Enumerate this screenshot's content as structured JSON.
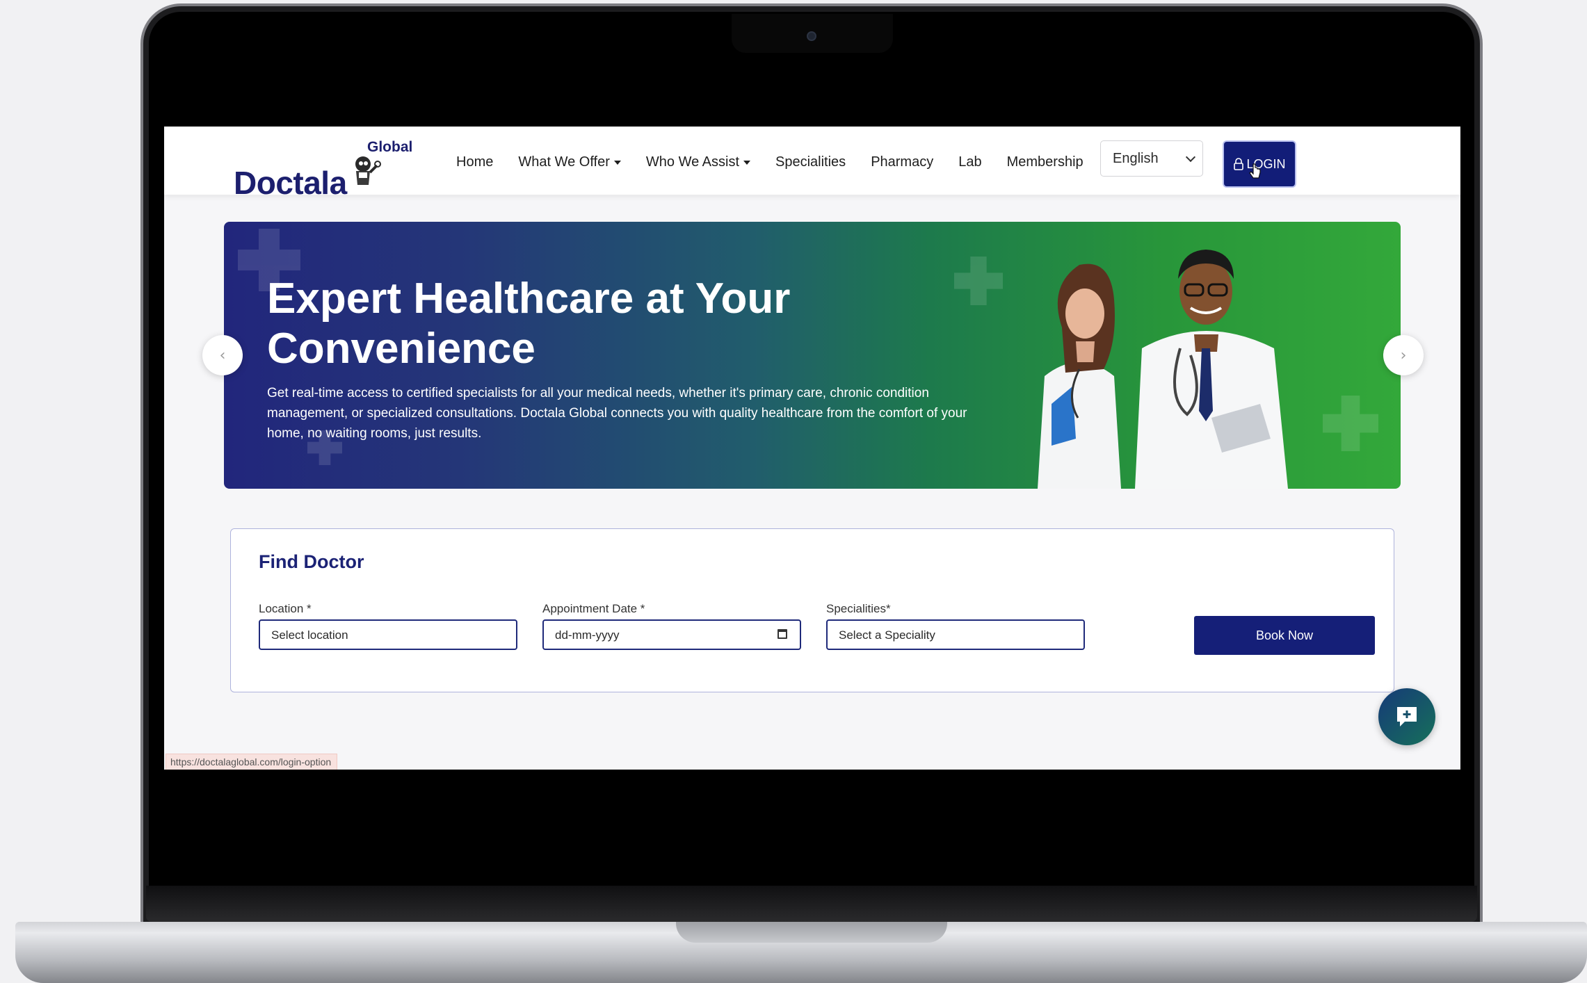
{
  "navbar": {
    "logo_text": "Doctala",
    "logo_superscript": "Global",
    "menu": [
      {
        "label": "Home",
        "has_dropdown": false
      },
      {
        "label": "What We Offer",
        "has_dropdown": true
      },
      {
        "label": "Who We Assist",
        "has_dropdown": true
      },
      {
        "label": "Specialities",
        "has_dropdown": false
      },
      {
        "label": "Pharmacy",
        "has_dropdown": false
      },
      {
        "label": "Lab",
        "has_dropdown": false
      },
      {
        "label": "Membership",
        "has_dropdown": false
      }
    ],
    "language": {
      "selected": "English"
    },
    "login_label": "LOGIN"
  },
  "hero": {
    "title": "Expert Healthcare at Your Convenience",
    "text": "Get real-time access to certified specialists for all your medical needs, whether it's primary care, chronic condition management, or specialized consultations. Doctala Global connects you with quality healthcare from the comfort of your home, no waiting rooms, just results.",
    "prev_arrow": "‹",
    "next_arrow": "›"
  },
  "find_doctor": {
    "title": "Find Doctor",
    "location": {
      "label": "Location *",
      "placeholder": "Select location"
    },
    "date": {
      "label": "Appointment Date *",
      "placeholder": "dd-mm-yyyy"
    },
    "speciality": {
      "label": "Specialities*",
      "placeholder": "Select a Speciality"
    },
    "book_label": "Book Now"
  },
  "status_bar": {
    "url": "https://doctalaglobal.com/login-option"
  },
  "colors": {
    "brand_navy": "#1b2275",
    "button_navy": "#121d78",
    "hero_green": "#33a83a",
    "hero_blue": "#22267c"
  },
  "icons": [
    "lock-icon",
    "chevron-down-icon",
    "calendar-icon",
    "chat-plus-icon",
    "chevron-left-icon",
    "chevron-right-icon",
    "mouse-pointer-icon"
  ]
}
